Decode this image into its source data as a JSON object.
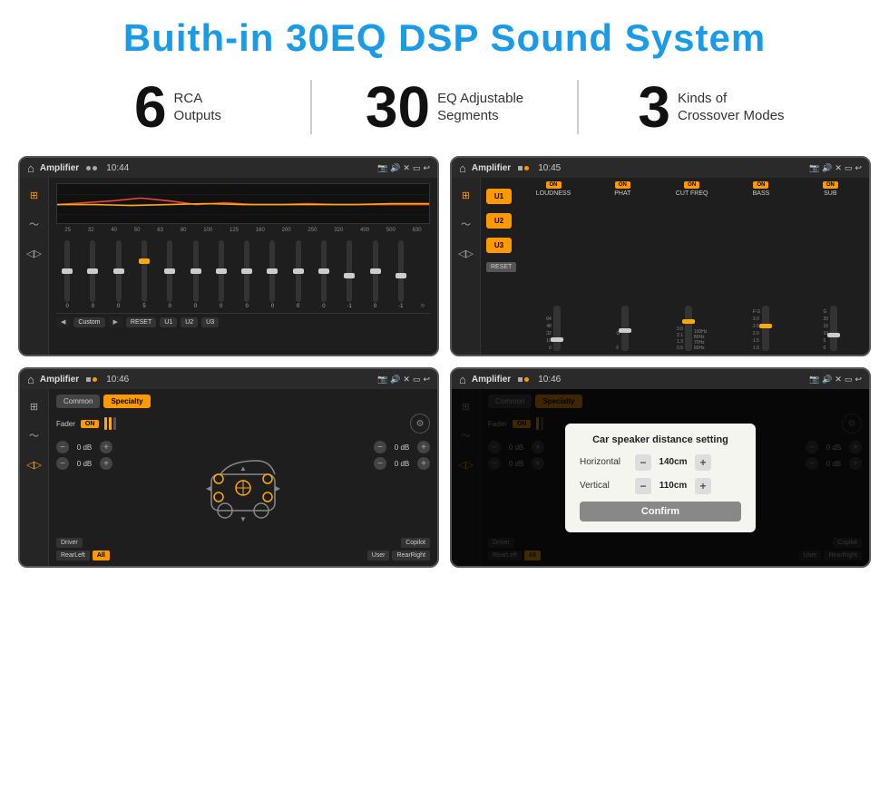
{
  "page": {
    "title": "Buith-in 30EQ DSP Sound System",
    "stats": [
      {
        "number": "6",
        "label": "RCA\nOutputs"
      },
      {
        "number": "30",
        "label": "EQ Adjustable\nSegments"
      },
      {
        "number": "3",
        "label": "Kinds of\nCrossover Modes"
      }
    ],
    "screens": [
      {
        "id": "eq-screen",
        "status_title": "Amplifier",
        "time": "10:44",
        "freqs": [
          "25",
          "32",
          "40",
          "50",
          "63",
          "80",
          "100",
          "125",
          "160",
          "200",
          "250",
          "320",
          "400",
          "500",
          "630"
        ],
        "sliders": [
          {
            "val": "0",
            "pos": 50
          },
          {
            "val": "0",
            "pos": 50
          },
          {
            "val": "0",
            "pos": 50
          },
          {
            "val": "5",
            "pos": 35
          },
          {
            "val": "0",
            "pos": 50
          },
          {
            "val": "0",
            "pos": 50
          },
          {
            "val": "0",
            "pos": 50
          },
          {
            "val": "0",
            "pos": 50
          },
          {
            "val": "0",
            "pos": 50
          },
          {
            "val": "0",
            "pos": 50
          },
          {
            "val": "0",
            "pos": 50
          },
          {
            "val": "-1",
            "pos": 55
          },
          {
            "val": "0",
            "pos": 50
          },
          {
            "val": "-1",
            "pos": 55
          }
        ],
        "bottom_btns": [
          "Custom",
          "RESET",
          "U1",
          "U2",
          "U3"
        ]
      },
      {
        "id": "crossover-screen",
        "status_title": "Amplifier",
        "time": "10:45",
        "u_buttons": [
          "U1",
          "U2",
          "U3"
        ],
        "controls": [
          {
            "label": "LOUDNESS",
            "on": true
          },
          {
            "label": "PHAT",
            "on": true
          },
          {
            "label": "CUT FREQ",
            "on": true
          },
          {
            "label": "BASS",
            "on": true
          },
          {
            "label": "SUB",
            "on": true
          }
        ],
        "reset_label": "RESET"
      },
      {
        "id": "speaker-screen",
        "status_title": "Amplifier",
        "time": "10:46",
        "tabs": [
          "Common",
          "Specialty"
        ],
        "active_tab": "Specialty",
        "fader_label": "Fader",
        "fader_on": "ON",
        "db_values": [
          "0 dB",
          "0 dB",
          "0 dB",
          "0 dB"
        ],
        "bottom_btns": [
          "Driver",
          "Copilot",
          "RearLeft",
          "All",
          "User",
          "RearRight"
        ],
        "active_btn": "All"
      },
      {
        "id": "dialog-screen",
        "status_title": "Amplifier",
        "time": "10:46",
        "tabs": [
          "Common",
          "Specialty"
        ],
        "dialog": {
          "title": "Car speaker distance setting",
          "rows": [
            {
              "label": "Horizontal",
              "value": "140cm"
            },
            {
              "label": "Vertical",
              "value": "110cm"
            }
          ],
          "confirm_label": "Confirm"
        },
        "db_values": [
          "0 dB",
          "0 dB"
        ],
        "bottom_btns": [
          "Driver",
          "Copilot",
          "RearLeft",
          "All",
          "User",
          "RearRight"
        ]
      }
    ]
  }
}
